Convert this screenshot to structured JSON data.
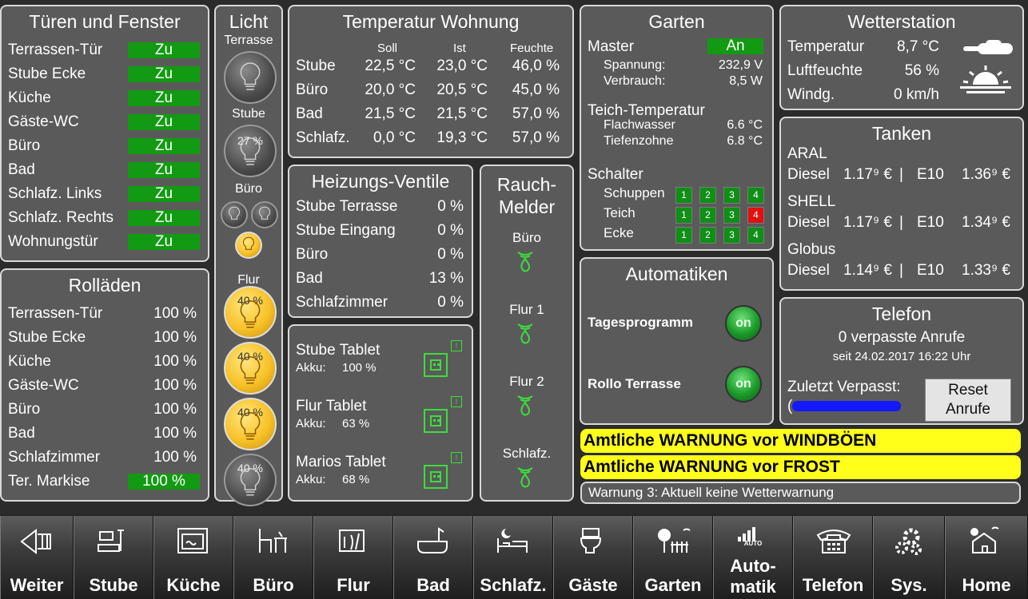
{
  "doors": {
    "title": "Türen und Fenster",
    "items": [
      {
        "label": "Terrassen-Tür",
        "state": "Zu"
      },
      {
        "label": "Stube Ecke",
        "state": "Zu"
      },
      {
        "label": "Küche",
        "state": "Zu"
      },
      {
        "label": "Gäste-WC",
        "state": "Zu"
      },
      {
        "label": "Büro",
        "state": "Zu"
      },
      {
        "label": "Bad",
        "state": "Zu"
      },
      {
        "label": "Schlafz. Links",
        "state": "Zu"
      },
      {
        "label": "Schlafz. Rechts",
        "state": "Zu"
      },
      {
        "label": "Wohnungstür",
        "state": "Zu"
      }
    ]
  },
  "shutters": {
    "title": "Rolläden",
    "items": [
      {
        "label": "Terrassen-Tür",
        "value": "100 %"
      },
      {
        "label": "Stube Ecke",
        "value": "100 %"
      },
      {
        "label": "Küche",
        "value": "100 %"
      },
      {
        "label": "Gäste-WC",
        "value": "100 %"
      },
      {
        "label": "Büro",
        "value": "100 %"
      },
      {
        "label": "Bad",
        "value": "100 %"
      },
      {
        "label": "Schlafzimmer",
        "value": "100 %"
      },
      {
        "label": "Ter. Markise",
        "value": "100 %"
      }
    ]
  },
  "light": {
    "title": "Licht",
    "terrasse": "Terrasse",
    "stube": "Stube",
    "stube_pct": "27 %",
    "buero": "Büro",
    "flur": "Flur",
    "flur_pcts": [
      "40 %",
      "40 %",
      "40 %",
      "40 %"
    ]
  },
  "temp": {
    "title": "Temperatur Wohnung",
    "head": [
      "Soll",
      "Ist",
      "Feuchte"
    ],
    "rows": [
      {
        "room": "Stube",
        "soll": "22,5 °C",
        "ist": "23,0 °C",
        "feuchte": "46,0 %"
      },
      {
        "room": "Büro",
        "soll": "20,0 °C",
        "ist": "20,5 °C",
        "feuchte": "45,0 %"
      },
      {
        "room": "Bad",
        "soll": "21,5 °C",
        "ist": "21,5 °C",
        "feuchte": "57,0 %"
      },
      {
        "room": "Schlafz.",
        "soll": "0,0 °C",
        "ist": "19,3 °C",
        "feuchte": "57,0 %"
      }
    ]
  },
  "valves": {
    "title": "Heizungs-Ventile",
    "items": [
      {
        "label": "Stube Terrasse",
        "value": "0 %"
      },
      {
        "label": "Stube Eingang",
        "value": "0 %"
      },
      {
        "label": "Büro",
        "value": "0 %"
      },
      {
        "label": "Bad",
        "value": "13 %"
      },
      {
        "label": "Schlafzimmer",
        "value": "0 %"
      }
    ]
  },
  "tablets": {
    "items": [
      {
        "name": "Stube Tablet",
        "akku": "Akku:",
        "pct": "100 %",
        "badge": "!"
      },
      {
        "name": "Flur Tablet",
        "akku": "Akku:",
        "pct": "63 %",
        "badge": "!"
      },
      {
        "name": "Marios Tablet",
        "akku": "Akku:",
        "pct": "68 %",
        "badge": "!"
      }
    ]
  },
  "smoke": {
    "title1": "Rauch-",
    "title2": "Melder",
    "items": [
      "Büro",
      "Flur 1",
      "Flur 2",
      "Schlafz."
    ]
  },
  "garden": {
    "title": "Garten",
    "master": "Master",
    "master_state": "An",
    "spannung": "Spannung:",
    "spannung_val": "232,9 V",
    "verbrauch": "Verbrauch:",
    "verbrauch_val": "8,5 W",
    "teich": "Teich-Temperatur",
    "flach": "Flachwasser",
    "flach_val": "6.6 °C",
    "tief": "Tiefenzohne",
    "tief_val": "6.8 °C",
    "schalter": "Schalter",
    "switches": [
      {
        "label": "Schuppen",
        "states": [
          "1",
          "2",
          "3",
          "4"
        ]
      },
      {
        "label": "Teich",
        "states": [
          "1",
          "2",
          "3",
          "4"
        ]
      },
      {
        "label": "Ecke",
        "states": [
          "1",
          "2",
          "3",
          "4"
        ]
      }
    ],
    "colors": {
      "on": "#0f8f16",
      "off": "#e01010"
    }
  },
  "auto": {
    "title": "Automatiken",
    "items": [
      {
        "label": "Tagesprogramm",
        "state": "on"
      },
      {
        "label": "Rollo Terrasse",
        "state": "on"
      }
    ]
  },
  "weather": {
    "title": "Wetterstation",
    "rows": [
      {
        "label": "Temperatur",
        "value": "8,7 °C"
      },
      {
        "label": "Luftfeuchte",
        "value": "56 %"
      },
      {
        "label": "Windg.",
        "value": "0 km/h"
      }
    ]
  },
  "tank": {
    "title": "Tanken",
    "stations": [
      {
        "name": "ARAL",
        "diesel": "Diesel",
        "diesel_price": "1.17⁹ €",
        "sep": "|",
        "e10": "E10",
        "e10_price": "1.36⁹ €"
      },
      {
        "name": "SHELL",
        "diesel": "Diesel",
        "diesel_price": "1.17⁹ €",
        "sep": "|",
        "e10": "E10",
        "e10_price": "1.34⁹ €"
      },
      {
        "name": "Globus",
        "diesel": "Diesel",
        "diesel_price": "1.14⁹ €",
        "sep": "|",
        "e10": "E10",
        "e10_price": "1.33⁹ €"
      }
    ]
  },
  "phone": {
    "title": "Telefon",
    "missed": "0 verpasste Anrufe",
    "since": "seit 24.02.2017 16:22 Uhr",
    "last": "Zuletzt Verpasst:",
    "last_prefix": "(",
    "reset1": "Reset",
    "reset2": "Anrufe"
  },
  "warnings": [
    "Amtliche WARNUNG vor WINDBÖEN",
    "Amtliche WARNUNG vor FROST",
    "Warnung 3: Aktuell keine Wetterwarnung"
  ],
  "nav": [
    {
      "label": "Weiter",
      "icon": "arrow-back-icon"
    },
    {
      "label": "Stube",
      "icon": "living-room-icon"
    },
    {
      "label": "Küche",
      "icon": "oven-icon"
    },
    {
      "label": "Büro",
      "icon": "desk-icon"
    },
    {
      "label": "Flur",
      "icon": "hallway-icon"
    },
    {
      "label": "Bad",
      "icon": "bathtub-icon"
    },
    {
      "label": "Schlafz.",
      "icon": "bed-icon"
    },
    {
      "label": "Gäste",
      "icon": "toilet-icon"
    },
    {
      "label": "Garten",
      "icon": "garden-icon"
    },
    {
      "label": "Auto-\nmatik",
      "icon": "automation-icon",
      "icon_text": "AUTO"
    },
    {
      "label": "Telefon",
      "icon": "telephone-icon"
    },
    {
      "label": "Sys.",
      "icon": "gears-icon"
    },
    {
      "label": "Home",
      "icon": "house-icon"
    }
  ],
  "colors": {
    "panel": "#5a5a5a",
    "green_state": "#129a12",
    "warning": "#ffff19",
    "tablet_icon": "#3adf3a"
  }
}
